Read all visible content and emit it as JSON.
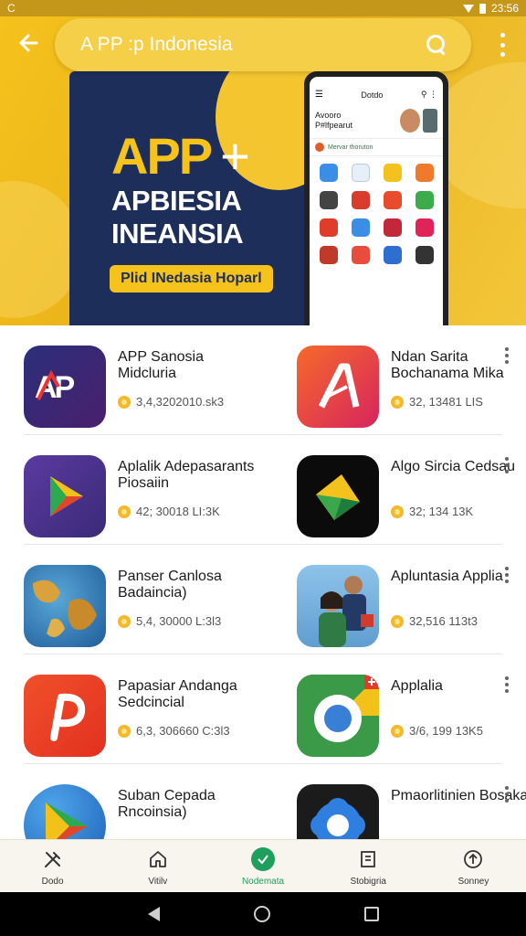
{
  "status_bar": {
    "left": "C",
    "time": "23:56"
  },
  "search": {
    "value": "A PP :p Indonesia"
  },
  "banner": {
    "headline": "APP",
    "headline_suffix": "+",
    "line2": "APBIESIA",
    "line3": "INEANSIA",
    "button": "Plid INedasia Hoparl"
  },
  "phone_mock": {
    "title": "Dotdo",
    "profile_line1": "Avooro",
    "profile_line2": "P#lfpearut",
    "notice": "Mervar thoruton"
  },
  "apps": [
    {
      "name": "APP Sanosia Midcluria",
      "meta": "3,4,3202010.sk3",
      "icon": "app-logo-icon"
    },
    {
      "name": "Ndan Sarita Bochanama Mika",
      "meta": "32, 13481 LIS",
      "icon": "stylized-a-icon"
    },
    {
      "name": "Aplalik Adepasarants Piosaiin",
      "meta": "42; 30018 LI:3K",
      "icon": "play-triangle-icon"
    },
    {
      "name": "Algo Sircia Cedsau",
      "meta": "32; 134 13K",
      "icon": "green-prism-icon"
    },
    {
      "name": "Panser Canlosa Badaincia)",
      "meta": "5,4, 30000 L:3l3",
      "icon": "globe-icon"
    },
    {
      "name": "Apluntasia Applia",
      "meta": "32,516 113t3",
      "icon": "people-photo-icon"
    },
    {
      "name": "Papasiar Andanga Sedcincial",
      "meta": "6,3, 306660 C:3l3",
      "icon": "p-logo-icon"
    },
    {
      "name": "Applalia",
      "meta": "3/6, 199 13K5",
      "icon": "chrome-icon"
    },
    {
      "name": "Suban Cepada Rncoinsia)",
      "meta": "",
      "icon": "play-store-icon"
    },
    {
      "name": "Pmaorlitinien Bosaka",
      "meta": "",
      "icon": "blue-flower-icon"
    }
  ],
  "bottom_nav": [
    {
      "label": "Dodo",
      "icon": "tools-icon"
    },
    {
      "label": "Vitilv",
      "icon": "home-icon"
    },
    {
      "label": "Nodemata",
      "icon": "check-icon",
      "active": true
    },
    {
      "label": "Stobigria",
      "icon": "document-icon"
    },
    {
      "label": "Sonney",
      "icon": "upload-icon"
    }
  ],
  "colors": {
    "accent": "#f5c21c",
    "banner_navy": "#1d2e5a",
    "active_nav": "#1f9f5c"
  }
}
